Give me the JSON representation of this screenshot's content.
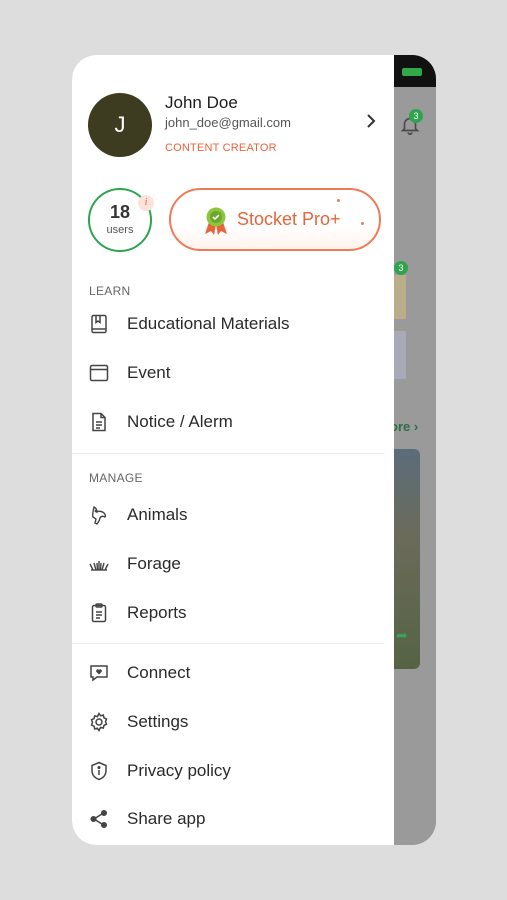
{
  "background": {
    "notification_count": "3",
    "badge_count": "3",
    "more_link": "ore ›"
  },
  "profile": {
    "initial": "J",
    "name": "John Doe",
    "email": "john_doe@gmail.com",
    "role": "CONTENT CREATOR"
  },
  "stats": {
    "users_count": "18",
    "users_label": "users",
    "info_symbol": "i"
  },
  "pro": {
    "label": "Stocket Pro+"
  },
  "sections": {
    "learn": "LEARN",
    "manage": "MANAGE"
  },
  "menu": {
    "educational_materials": "Educational Materials",
    "event": "Event",
    "notice": "Notice / Alerm",
    "animals": "Animals",
    "forage": "Forage",
    "reports": "Reports",
    "connect": "Connect",
    "settings": "Settings",
    "privacy": "Privacy policy",
    "share": "Share app"
  },
  "colors": {
    "accent": "#e8643a",
    "green": "#2ea44f",
    "avatar": "#3e3c20"
  }
}
